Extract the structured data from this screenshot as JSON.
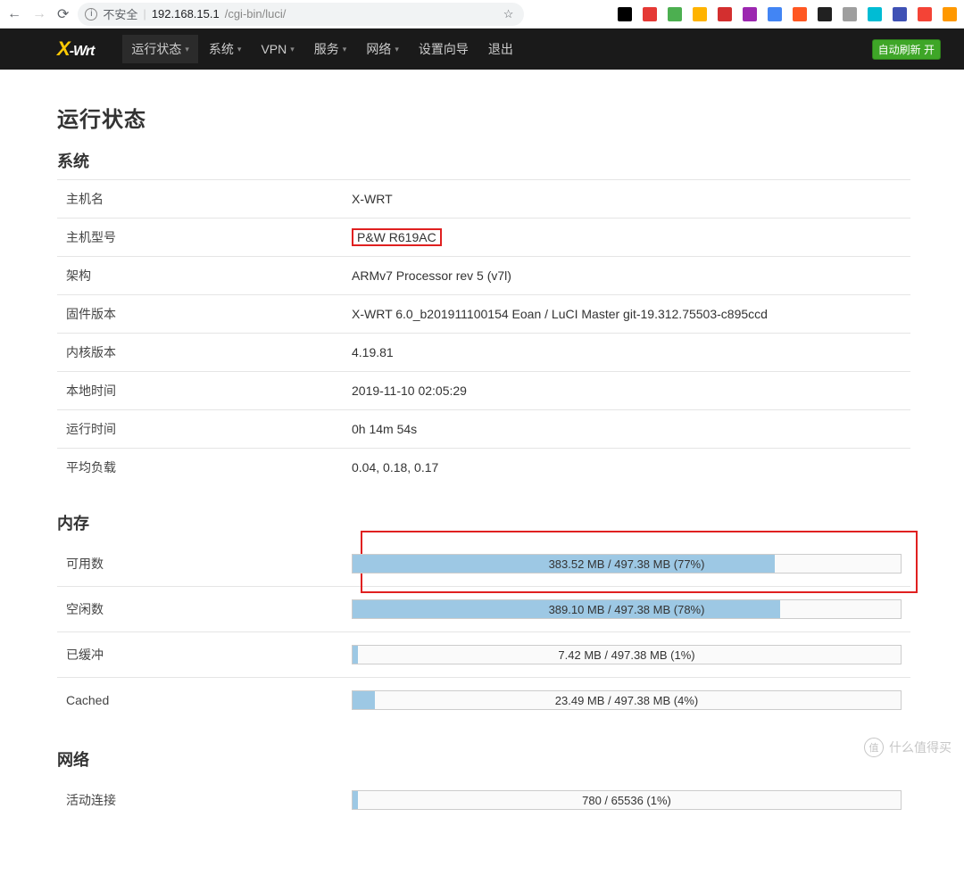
{
  "browser": {
    "insecure_label": "不安全",
    "url_host": "192.168.15.1",
    "url_path": "/cgi-bin/luci/"
  },
  "logo": {
    "x": "X",
    "wrt": "-Wrt"
  },
  "nav": {
    "status": "运行状态",
    "system": "系统",
    "vpn": "VPN",
    "services": "服务",
    "network": "网络",
    "wizard": "设置向导",
    "logout": "退出"
  },
  "refresh_label": "自动刷新 开",
  "page_title": "运行状态",
  "sections": {
    "system": "系统",
    "memory": "内存",
    "network": "网络"
  },
  "system": {
    "hostname_label": "主机名",
    "hostname": "X-WRT",
    "model_label": "主机型号",
    "model": "P&W R619AC",
    "arch_label": "架构",
    "arch": "ARMv7 Processor rev 5 (v7l)",
    "firmware_label": "固件版本",
    "firmware": "X-WRT 6.0_b201911100154 Eoan / LuCI Master git-19.312.75503-c895ccd",
    "kernel_label": "内核版本",
    "kernel": "4.19.81",
    "localtime_label": "本地时间",
    "localtime": "2019-11-10 02:05:29",
    "uptime_label": "运行时间",
    "uptime": "0h 14m 54s",
    "load_label": "平均负载",
    "load": "0.04, 0.18, 0.17"
  },
  "memory": {
    "available_label": "可用数",
    "available_text": "383.52 MB / 497.38 MB (77%)",
    "available_pct": 77,
    "free_label": "空闲数",
    "free_text": "389.10 MB / 497.38 MB (78%)",
    "free_pct": 78,
    "buffered_label": "已缓冲",
    "buffered_text": "7.42 MB / 497.38 MB (1%)",
    "buffered_pct": 1,
    "cached_label": "Cached",
    "cached_text": "23.49 MB / 497.38 MB (4%)",
    "cached_pct": 4
  },
  "network": {
    "active_label": "活动连接",
    "active_text": "780 / 65536 (1%)",
    "active_pct": 1
  },
  "watermark": "什么值得买",
  "ext_colors": [
    "#000",
    "#e53935",
    "#4caf50",
    "#ffb300",
    "#d32f2f",
    "#9c27b0",
    "#4285f4",
    "#ff5722",
    "#212121",
    "#9e9e9e",
    "#00bcd4",
    "#3f51b5",
    "#f44336",
    "#ff9800"
  ]
}
